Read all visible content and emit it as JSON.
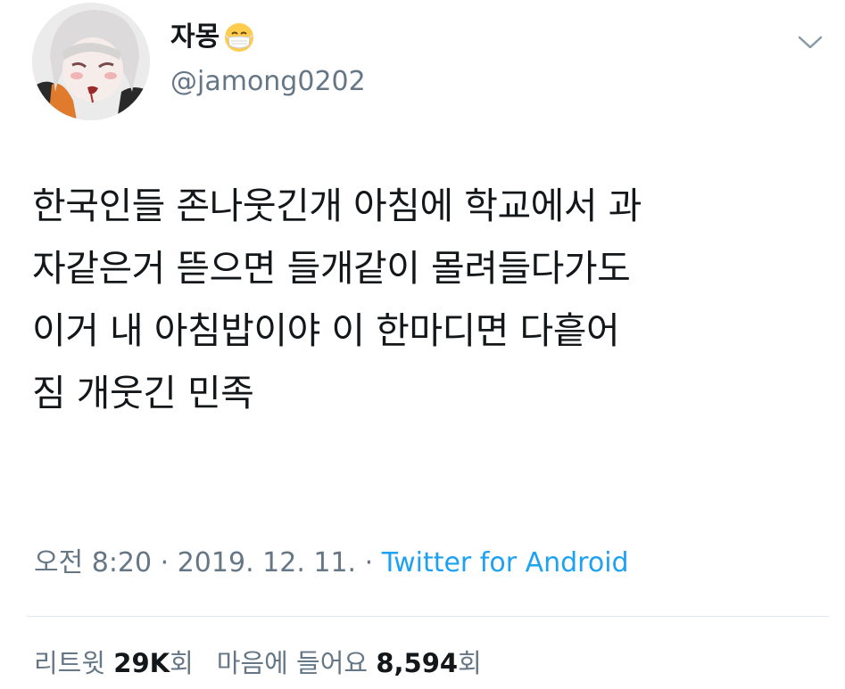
{
  "user": {
    "display_name": "자몽",
    "handle": "@jamong0202",
    "name_emoji_icon": "face-with-medical-mask-emoji"
  },
  "tweet": {
    "text": "한국인들 존나웃긴개 아침에 학교에서 과\n자같은거 뜯으면 들개같이 몰려들다가도\n이거 내 아침밥이야 이 한마디면 다흩어\n짐 개웃긴 민족"
  },
  "meta": {
    "time": "오전 8:20",
    "separator1": " · ",
    "date": "2019. 12. 11.",
    "separator2": " · ",
    "source": "Twitter for Android"
  },
  "stats": {
    "retweet_label": "리트윗",
    "retweet_count": "29K",
    "retweet_unit": "회",
    "like_label": "마음에 들어요",
    "like_count": "8,594",
    "like_unit": "회"
  },
  "colors": {
    "text": "#14171a",
    "secondary": "#657786",
    "link": "#1da1f2",
    "divider": "#e1e8ed"
  }
}
